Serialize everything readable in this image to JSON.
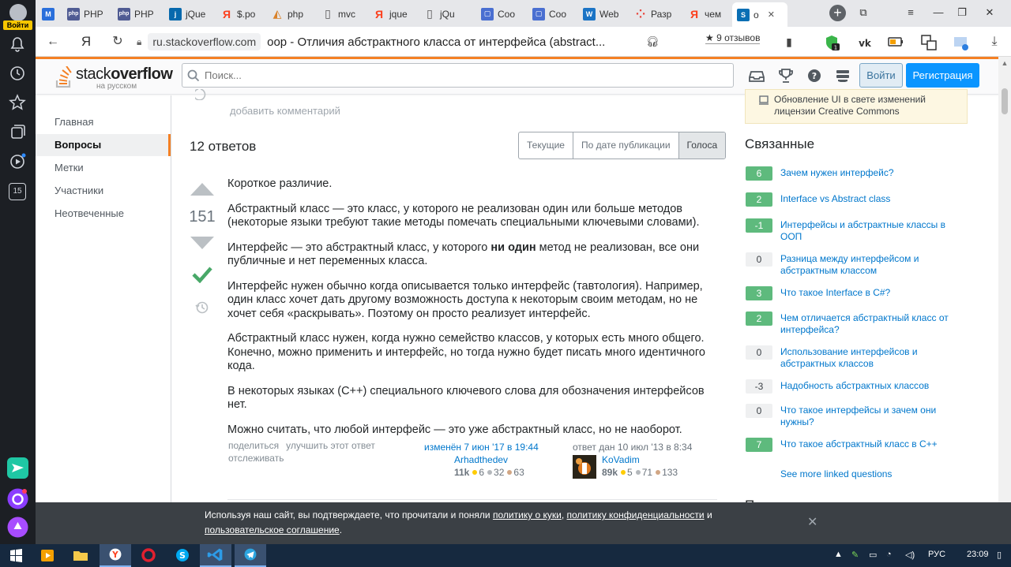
{
  "panel": {
    "login_label": "Войти",
    "badge_15": "15"
  },
  "tabs": [
    {
      "label": "",
      "favicon": "gmail-icon",
      "color": "#2a6fdb",
      "glyph": "M"
    },
    {
      "label": "PHP",
      "favicon": "php-icon",
      "color": "#4f5b93",
      "glyph": "php"
    },
    {
      "label": "PHP",
      "favicon": "php-icon",
      "color": "#4f5b93",
      "glyph": "php"
    },
    {
      "label": "jQue",
      "favicon": "jquery-icon",
      "color": "#0769ad",
      "glyph": "j"
    },
    {
      "label": "$.po",
      "favicon": "yandex-icon",
      "color": "#fc3f1d",
      "glyph": "Я"
    },
    {
      "label": "php",
      "favicon": "sketch-icon",
      "color": "#d9822b",
      "glyph": "◭"
    },
    {
      "label": "mvc",
      "favicon": "doc-icon",
      "color": "#666",
      "glyph": "▯"
    },
    {
      "label": "jque",
      "favicon": "yandex-icon",
      "color": "#fc3f1d",
      "glyph": "Я"
    },
    {
      "label": "jQu",
      "favicon": "doc-icon",
      "color": "#666",
      "glyph": "▯"
    },
    {
      "label": "Coo",
      "favicon": "chat-icon",
      "color": "#4a6fd1",
      "glyph": "▢"
    },
    {
      "label": "Coo",
      "favicon": "chat-icon",
      "color": "#4a6fd1",
      "glyph": "▢"
    },
    {
      "label": "Web",
      "favicon": "w-icon",
      "color": "#1b74c5",
      "glyph": "W"
    },
    {
      "label": "Разр",
      "favicon": "dots-icon",
      "color": "#e8453c",
      "glyph": "⁘"
    },
    {
      "label": "чем",
      "favicon": "yandex-icon",
      "color": "#fc3f1d",
      "glyph": "Я"
    },
    {
      "label": "о",
      "favicon": "stackoverflow-icon",
      "color": "#0a6fb4",
      "glyph": "S"
    }
  ],
  "address": {
    "host": "ru.stackoverflow.com",
    "title": "oop - Отличия абстрактного класса от интерфейса (abstract...",
    "reviews": "9 отзывов",
    "reviews_star": "★"
  },
  "header": {
    "logo_word": "stack",
    "logo_word_bold": "overflow",
    "logo_sub": "на русском",
    "search_placeholder": "Поиск...",
    "login": "Войти",
    "register": "Регистрация"
  },
  "leftnav": [
    "Главная",
    "Вопросы",
    "Метки",
    "Участники",
    "Неотвеченные"
  ],
  "main": {
    "add_comment": "добавить комментарий",
    "answers_count": "12 ответов",
    "sort_tabs": [
      "Текущие",
      "По дате публикации",
      "Голоса"
    ],
    "votes": "151",
    "post": {
      "p1": "Короткое различие.",
      "p2": "Абстрактный класс — это класс, у которого не реализован один или больше методов (некоторые языки требуют такие методы помечать специальными ключевыми словами).",
      "p3a": "Интерфейс — это абстрактный класс, у которого ",
      "p3b": "ни один",
      "p3c": " метод не реализован, все они публичные и нет переменных класса.",
      "p4": "Интерфейс нужен обычно когда описывается только интерфейс (тавтология). Например, один класс хочет дать другому возможность доступа к некоторым своим методам, но не хочет себя «раскрывать». Поэтому он просто реализует интерфейс.",
      "p5": "Абстрактный класс нужен, когда нужно семейство классов, у которых есть много общего. Конечно, можно применить и интерфейс, но тогда нужно будет писать много идентичного кода.",
      "p6": "В некоторых языках (C++) специального ключевого слова для обозначения интерфейсов нет.",
      "p7": "Можно считать, что любой интерфейс — это уже абстрактный класс, но не наоборот."
    },
    "menu": {
      "share": "поделиться",
      "improve": "улучшить этот ответ",
      "follow": "отслеживать"
    },
    "editor": {
      "action": "изменён 7 июн '17 в 19:44",
      "name": "Arhadthedev",
      "rep": "11k",
      "gold": "6",
      "silver": "32",
      "bronze": "63"
    },
    "author": {
      "action": "ответ дан 10 июл '13 в 8:34",
      "name": "KoVadim",
      "rep": "89k",
      "gold": "5",
      "silver": "71",
      "bronze": "133"
    }
  },
  "sidebar": {
    "notice": "Обновление UI в свете изменений лицензии Creative Commons",
    "related_title": "Связанные",
    "related": [
      {
        "score": "6",
        "title": "Зачем нужен интерфейс?",
        "pos": true
      },
      {
        "score": "2",
        "title": "Interface vs Abstract class",
        "pos": true
      },
      {
        "score": "-1",
        "title": "Интерфейсы и абстрактные классы в ООП",
        "pos": true
      },
      {
        "score": "0",
        "title": "Разница между интерфейсом и абстрактным классом",
        "pos": false
      },
      {
        "score": "3",
        "title": "Что такое Interface в C#?",
        "pos": true
      },
      {
        "score": "2",
        "title": "Чем отличается абстрактный класс от интерфейса?",
        "pos": true
      },
      {
        "score": "0",
        "title": "Использование интерфейсов и абстрактных классов",
        "pos": false
      },
      {
        "score": "-3",
        "title": "Надобность абстрактных классов",
        "pos": false
      },
      {
        "score": "0",
        "title": "Что такое интерфейсы и зачем они нужны?",
        "pos": false
      },
      {
        "score": "7",
        "title": "Что такое абстрактный класс в C++",
        "pos": true
      }
    ],
    "more": "See more linked questions",
    "hot_title": "Похожие"
  },
  "cookie": {
    "t1": "Используя наш сайт, вы подтверждаете, что прочитали и поняли ",
    "l1": "политику о куки",
    "t2": ", ",
    "l2": "политику конфиденциальности",
    "t3": " и ",
    "l3": "пользовательское соглашение",
    "t4": ".",
    "close": "✕"
  },
  "taskbar": {
    "lang": "РУС",
    "time": "23:09"
  }
}
